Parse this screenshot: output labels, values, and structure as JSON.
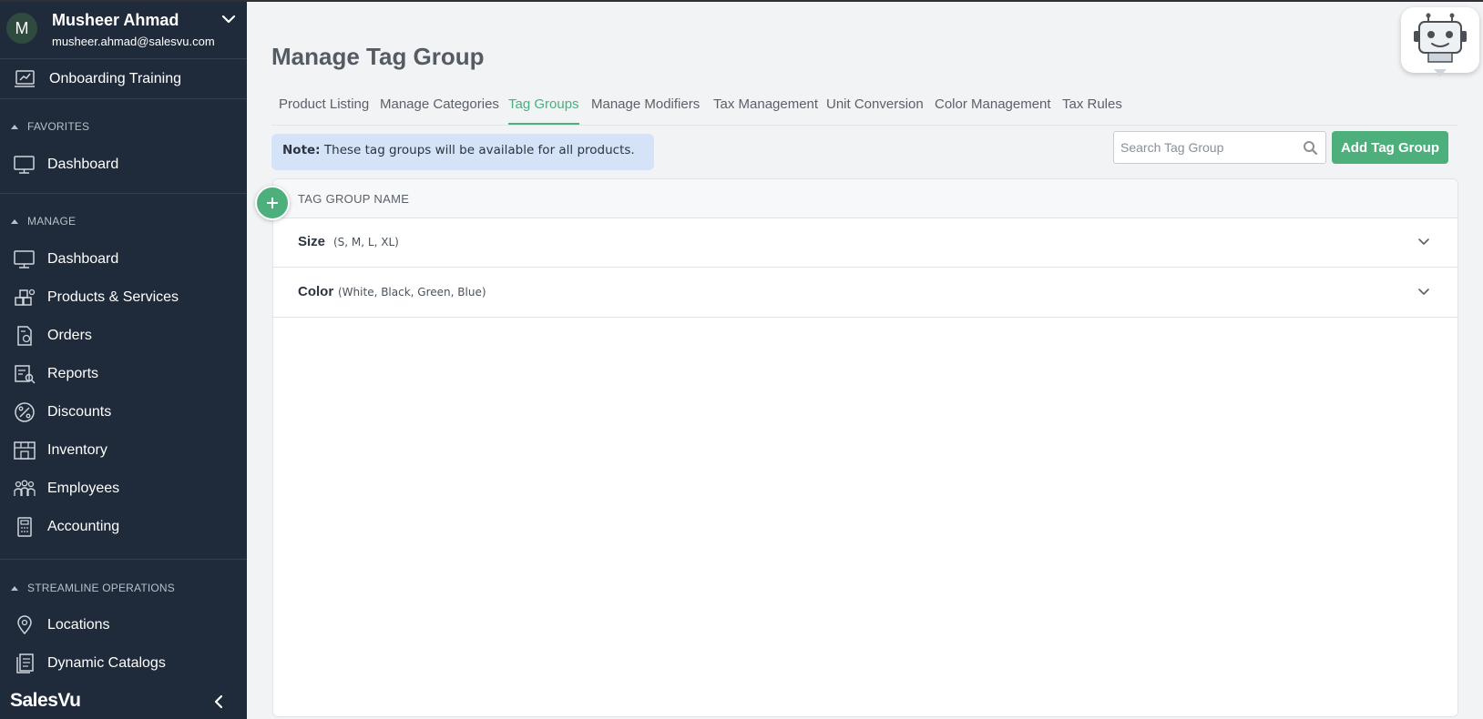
{
  "profile": {
    "initial": "M",
    "name": "Musheer Ahmad",
    "email": "musheer.ahmad@salesvu.com"
  },
  "sidebar": {
    "onboarding": "Onboarding Training",
    "favorites_header": "FAVORITES",
    "favorites": [
      {
        "label": "Dashboard",
        "icon": "monitor-icon"
      }
    ],
    "manage_header": "MANAGE",
    "manage": [
      {
        "label": "Dashboard",
        "icon": "monitor-icon"
      },
      {
        "label": "Products & Services",
        "icon": "boxes-icon"
      },
      {
        "label": "Orders",
        "icon": "orders-icon"
      },
      {
        "label": "Reports",
        "icon": "reports-icon"
      },
      {
        "label": "Discounts",
        "icon": "percent-icon"
      },
      {
        "label": "Inventory",
        "icon": "inventory-icon"
      },
      {
        "label": "Employees",
        "icon": "employees-icon"
      },
      {
        "label": "Accounting",
        "icon": "calculator-icon"
      }
    ],
    "streamline_header": "STREAMLINE OPERATIONS",
    "streamline": [
      {
        "label": "Locations",
        "icon": "location-pin-icon"
      },
      {
        "label": "Dynamic Catalogs",
        "icon": "catalog-icon"
      }
    ],
    "brand": "SalesVu"
  },
  "main": {
    "title": "Manage Tag Group",
    "tabs": [
      {
        "label": "Product Listing",
        "active": false
      },
      {
        "label": "Manage Categories",
        "active": false
      },
      {
        "label": "Tag Groups",
        "active": true
      },
      {
        "label": "Manage Modifiers",
        "active": false
      },
      {
        "label": "Tax Management",
        "active": false
      },
      {
        "label": "Unit Conversion",
        "active": false
      },
      {
        "label": "Color Management",
        "active": false
      },
      {
        "label": "Tax Rules",
        "active": false
      }
    ],
    "note_prefix": "Note:",
    "note_text": " These tag groups will be available for all products.",
    "search_placeholder": "Search Tag Group",
    "add_button": "Add Tag Group",
    "table_header": "TAG GROUP NAME",
    "rows": [
      {
        "name": "Size",
        "values": "(S, M, L, XL)"
      },
      {
        "name": "Color",
        "values": "(White, Black, Green, Blue)"
      }
    ]
  },
  "colors": {
    "sidebar_bg": "#1f2a3a",
    "accent": "#4db07c",
    "note_bg": "#d5e3f8"
  }
}
